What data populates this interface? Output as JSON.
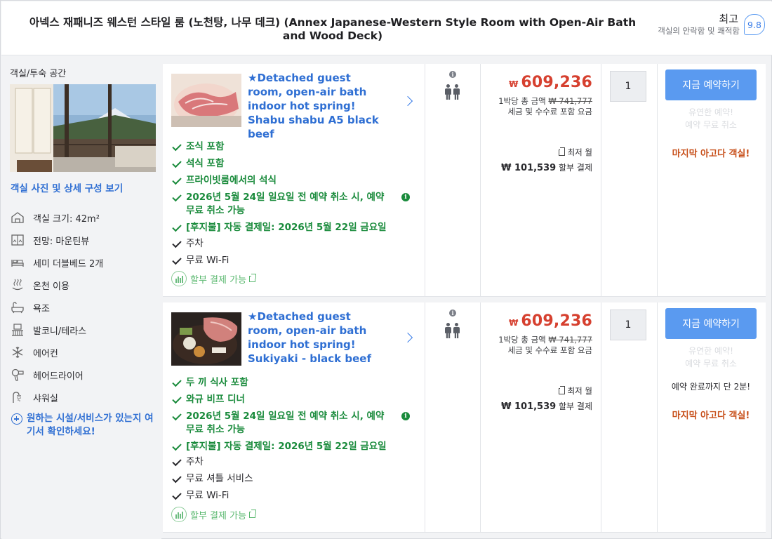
{
  "header": {
    "room_title": "아넥스 재패니즈 웨스턴 스타일 룸 (노천탕, 나무 데크) (Annex Japanese-Western Style Room with Open-Air Bath and Wood Deck)",
    "score_word": "최고",
    "score_desc": "객실의 안락함 및 쾌적함",
    "score_value": "9.8"
  },
  "sidebar": {
    "label": "객실/투숙 공간",
    "photo_link": "객실 사진 및 상세 구성 보기",
    "amenities": [
      {
        "icon": "house-icon",
        "label": "객실 크기: 42m²"
      },
      {
        "icon": "window-view-icon",
        "label": "전망: 마운틴뷰"
      },
      {
        "icon": "bed-icon",
        "label": "세미 더블베드 2개"
      },
      {
        "icon": "hot-spring-icon",
        "label": "온천 이용"
      },
      {
        "icon": "bathtub-icon",
        "label": "욕조"
      },
      {
        "icon": "balcony-icon",
        "label": "발코니/테라스"
      },
      {
        "icon": "snowflake-icon",
        "label": "에어컨"
      },
      {
        "icon": "hairdryer-icon",
        "label": "헤어드라이어"
      },
      {
        "icon": "shower-icon",
        "label": "샤워실"
      }
    ],
    "more_link": "원하는 시설/서비스가 있는지 여기서 확인하세요!"
  },
  "offers": [
    {
      "title": "★Detached guest room, open-air bath indoor hot spring! Shabu shabu A5 black beef",
      "features": [
        {
          "style": "green",
          "text": "조식 포함",
          "info": false
        },
        {
          "style": "green",
          "text": "석식 포함",
          "info": false
        },
        {
          "style": "green",
          "text": "프라이빗룸에서의 석식",
          "info": false
        },
        {
          "style": "green",
          "text": "2026년 5월 24일 일요일 전 예약 취소 시, 예약 무료 취소 가능",
          "info": true
        },
        {
          "style": "green",
          "text": "[후지불] 자동 결제일: 2026년 5월 22일 금요일",
          "info": false
        },
        {
          "style": "black",
          "text": "주차",
          "info": false
        },
        {
          "style": "black",
          "text": "무료 Wi-Fi",
          "info": false
        }
      ],
      "installment": "할부 결제 가능",
      "currency": "₩",
      "price": "609,236",
      "price_sub_prefix": "1박당 총 금액",
      "price_sub_strike": "₩ 741,777",
      "price_sub_line2": "세금 및 수수료 포함 요금",
      "min_label": "최저 월",
      "monthly_amount": "₩ 101,539",
      "monthly_suffix": "할부 결제",
      "quantity": "1",
      "book_label": "지금 예약하기",
      "faded_1": "유연한 예약!",
      "faded_2": "예약 무료 취소",
      "urgency": "",
      "last_room": "마지막 아고다 객실!"
    },
    {
      "title": "★Detached guest room, open-air bath indoor hot spring! Sukiyaki - black beef",
      "features": [
        {
          "style": "green",
          "text": "두 끼 식사 포함",
          "info": false
        },
        {
          "style": "green",
          "text": "와규 비프 디너",
          "info": false
        },
        {
          "style": "green",
          "text": "2026년 5월 24일 일요일 전 예약 취소 시, 예약 무료 취소 가능",
          "info": true
        },
        {
          "style": "green",
          "text": "[후지불] 자동 결제일: 2026년 5월 22일 금요일",
          "info": false
        },
        {
          "style": "black",
          "text": "주차",
          "info": false
        },
        {
          "style": "black",
          "text": "무료 셔틀 서비스",
          "info": false
        },
        {
          "style": "black",
          "text": "무료 Wi-Fi",
          "info": false
        }
      ],
      "installment": "할부 결제 가능",
      "currency": "₩",
      "price": "609,236",
      "price_sub_prefix": "1박당 총 금액",
      "price_sub_strike": "₩ 741,777",
      "price_sub_line2": "세금 및 수수료 포함 요금",
      "min_label": "최저 월",
      "monthly_amount": "₩ 101,539",
      "monthly_suffix": "할부 결제",
      "quantity": "1",
      "book_label": "지금 예약하기",
      "faded_1": "유연한 예약!",
      "faded_2": "예약 무료 취소",
      "urgency": "예약 완료까지 단 2분!",
      "last_room": "마지막 아고다 객실!"
    }
  ]
}
